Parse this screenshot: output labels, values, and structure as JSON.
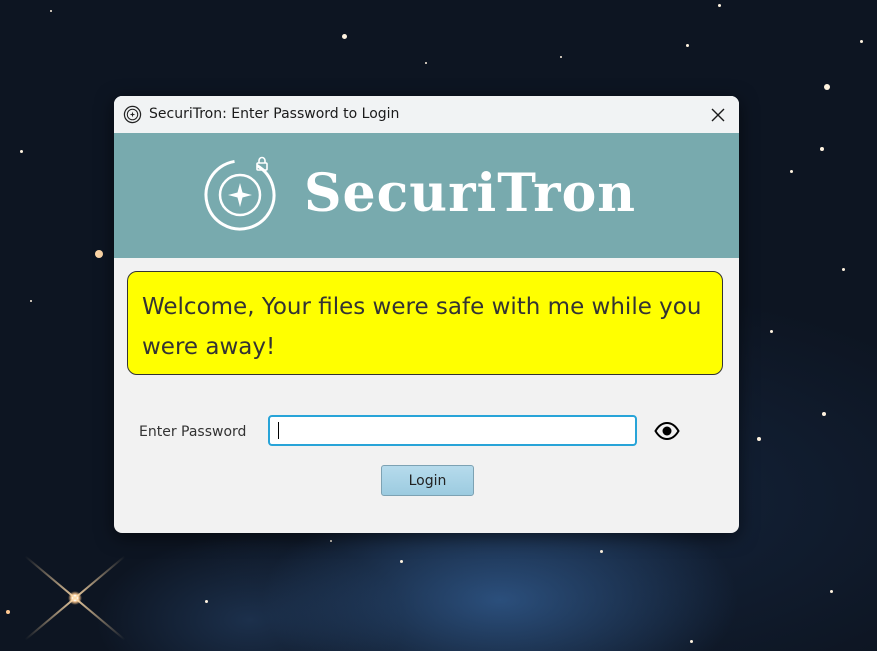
{
  "window": {
    "title": "SecuriTron: Enter Password to Login",
    "close_icon": "close-icon",
    "app_icon": "securitron-logo-icon"
  },
  "banner": {
    "brand_name": "SecuriTron",
    "background_color": "#78aaae",
    "logo_icon": "securitron-logo-icon"
  },
  "welcome": {
    "message": "Welcome, Your files were safe with me while you were away!",
    "background_color": "#ffff00"
  },
  "login_form": {
    "password_label": "Enter Password",
    "password_value": "",
    "show_password_icon": "eye-icon",
    "login_button_label": "Login",
    "focus_color": "#28a4d8"
  }
}
